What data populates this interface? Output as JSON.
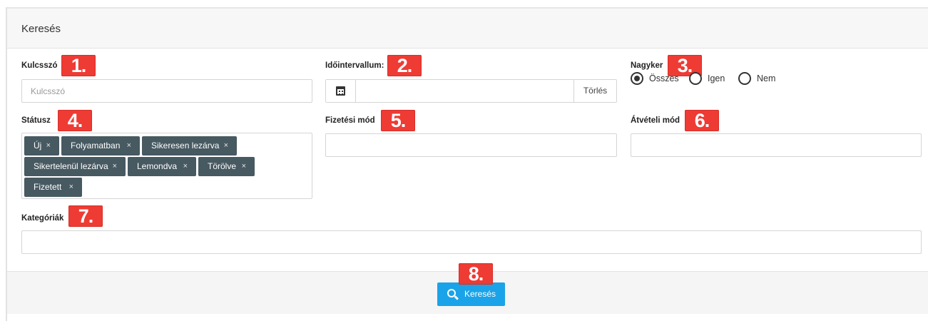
{
  "panel": {
    "title": "Keresés"
  },
  "fields": {
    "keyword": {
      "label": "Kulcsszó",
      "placeholder": "Kulcsszó",
      "badge": "1."
    },
    "interval": {
      "label": "Időintervallum:",
      "value": "",
      "clear_label": "Törlés",
      "badge": "2."
    },
    "wholesale": {
      "label": "Nagyker",
      "badge": "3.",
      "options": [
        {
          "label": "Összes",
          "selected": true
        },
        {
          "label": "Igen",
          "selected": false
        },
        {
          "label": "Nem",
          "selected": false
        }
      ]
    },
    "status": {
      "label": "Státusz",
      "badge": "4.",
      "tags": [
        "Új",
        "Folyamatban",
        "Sikeresen lezárva",
        "Sikertelenül lezárva",
        "Lemondva",
        "Törölve",
        "Fizetett"
      ],
      "remove_glyph": "×"
    },
    "payment": {
      "label": "Fizetési mód",
      "badge": "5.",
      "value": ""
    },
    "shipping": {
      "label": "Átvételi mód",
      "badge": "6.",
      "value": ""
    },
    "categories": {
      "label": "Kategóriák",
      "badge": "7.",
      "value": ""
    }
  },
  "footer": {
    "badge": "8.",
    "search_label": "Keresés"
  },
  "colors": {
    "badge": "#ee3b34",
    "tag": "#475961",
    "button": "#1aa3e8"
  },
  "icons": {
    "interval": "calendar-icon",
    "search": "magnifier-icon",
    "tag_remove": "close-icon"
  }
}
